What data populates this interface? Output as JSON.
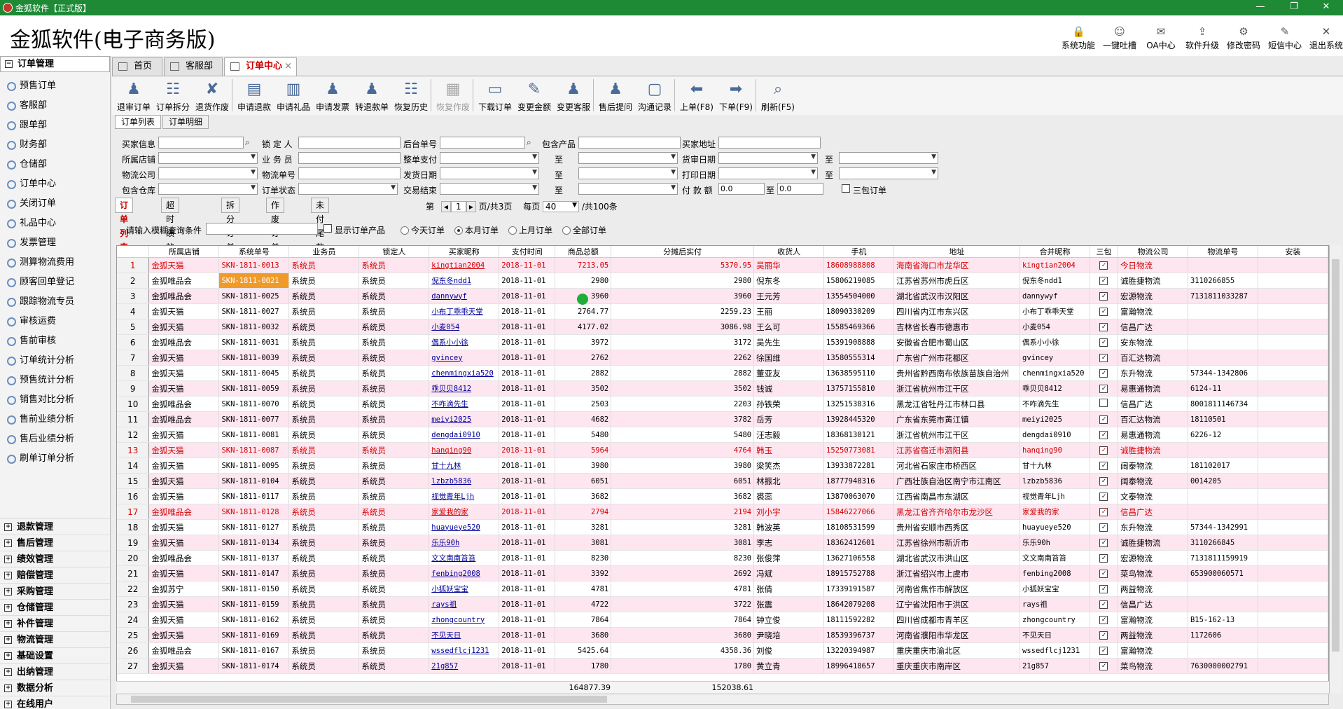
{
  "window": {
    "title": "金狐软件【正式版】",
    "controls": [
      "—",
      "❐",
      "✕"
    ]
  },
  "app_title": "金狐软件(电子商务版)",
  "header_buttons": [
    {
      "label": "系统功能",
      "icon": "lock-icon",
      "glyph": "🔒"
    },
    {
      "label": "一键吐槽",
      "icon": "smiley-icon",
      "glyph": "☺"
    },
    {
      "label": "OA中心",
      "icon": "mail-icon",
      "glyph": "✉"
    },
    {
      "label": "软件升级",
      "icon": "upgrade-icon",
      "glyph": "⇪"
    },
    {
      "label": "修改密码",
      "icon": "gear-icon",
      "glyph": "⚙"
    },
    {
      "label": "短信中心",
      "icon": "chat-icon",
      "glyph": "✎"
    },
    {
      "label": "退出系统",
      "icon": "exit-icon",
      "glyph": "✕"
    }
  ],
  "sidebar": {
    "section": "订单管理",
    "items": [
      "预售订单",
      "客服部",
      "跟单部",
      "财务部",
      "仓储部",
      "订单中心",
      "关闭订单",
      "礼品中心",
      "发票管理",
      "测算物流费用",
      "顾客回单登记",
      "跟踪物流专员",
      "审核运费",
      "售前审核",
      "订单统计分析",
      "预售统计分析",
      "销售对比分析",
      "售前业绩分析",
      "售后业绩分析",
      "刷单订单分析"
    ],
    "bottom": [
      "退款管理",
      "售后管理",
      "绩效管理",
      "赔偿管理",
      "采购管理",
      "仓储管理",
      "补件管理",
      "物流管理",
      "基础设置",
      "出纳管理",
      "数据分析",
      "在线用户"
    ]
  },
  "tabs": [
    "首页",
    "客服部",
    "订单中心"
  ],
  "toolbar": [
    {
      "label": "退审订单",
      "icon": "person-icon",
      "glyph": "♟"
    },
    {
      "label": "订单拆分",
      "icon": "database-icon",
      "glyph": "☷"
    },
    {
      "label": "退货作废",
      "icon": "doc-delete-icon",
      "glyph": "✘"
    },
    {
      "label": "申请退款",
      "icon": "form-icon",
      "glyph": "▤"
    },
    {
      "label": "申请礼品",
      "icon": "gift-icon",
      "glyph": "▥"
    },
    {
      "label": "申请发票",
      "icon": "person-warn-icon",
      "glyph": "♟"
    },
    {
      "label": "转退款单",
      "icon": "person-warn-icon",
      "glyph": "♟"
    },
    {
      "label": "恢复历史",
      "icon": "db-restore-icon",
      "glyph": "☷"
    },
    {
      "label": "恢复作废",
      "icon": "doc-icon",
      "glyph": "▦",
      "disabled": true
    },
    {
      "label": "下载订单",
      "icon": "monitor-icon",
      "glyph": "▭"
    },
    {
      "label": "变更金额",
      "icon": "pencil-icon",
      "glyph": "✎"
    },
    {
      "label": "变更客服",
      "icon": "person-icon",
      "glyph": "♟"
    },
    {
      "label": "售后提问",
      "icon": "person-icon",
      "glyph": "♟"
    },
    {
      "label": "沟通记录",
      "icon": "speech-icon",
      "glyph": "▢"
    },
    {
      "label": "上单(F8)",
      "icon": "arrow-left-icon",
      "glyph": "⬅"
    },
    {
      "label": "下单(F9)",
      "icon": "arrow-right-icon",
      "glyph": "➡"
    },
    {
      "label": "刷新(F5)",
      "icon": "magnifier-icon",
      "glyph": "⌕"
    }
  ],
  "subtabs": [
    "订单列表",
    "订单明细"
  ],
  "filters": {
    "买家信息": "买家信息",
    "锁定人": "锁 定 人",
    "后台单号": "后台单号",
    "包含产品": "包含产品",
    "买家地址": "买家地址",
    "所属店铺": "所属店铺",
    "业务员": "业 务 员",
    "整单支付": "整单支付",
    "至1": "至",
    "货审日期": "货审日期",
    "至2": "至",
    "物流公司": "物流公司",
    "物流单号": "物流单号",
    "发货日期": "发货日期",
    "至3": "至",
    "打印日期": "打印日期",
    "至4": "至",
    "包含仓库": "包含仓库",
    "订单状态": "订单状态",
    "交易结束": "交易结束",
    "至5": "至",
    "付款额": "付 款 额",
    "付款额从": "0.0",
    "至6": "至",
    "付款额到": "0.0",
    "三包订单": "三包订单"
  },
  "list_tabs": [
    "订单列表",
    "超时绩效统计",
    "拆分订单",
    "作废订单",
    "未付尾款预售订单"
  ],
  "pager": {
    "di": "第",
    "page": "1",
    "of": "页/共3页",
    "per_label": "每页",
    "per": "40",
    "total": "/共100条"
  },
  "search": {
    "label": "请输入模糊查询条件",
    "show_products": "显示订单产品",
    "radios": [
      "今天订单",
      "本月订单",
      "上月订单",
      "全部订单"
    ],
    "selected": "本月订单"
  },
  "columns": [
    "所属店铺",
    "系统单号",
    "业务员",
    "锁定人",
    "买家昵称",
    "支付时间",
    "商品总额",
    "分摊后实付",
    "收货人",
    "手机",
    "地址",
    "合并昵称",
    "三包",
    "物流公司",
    "物流单号",
    "安装"
  ],
  "rows": [
    [
      "金狐天猫",
      "SKN-1811-0013",
      "系统员",
      "系统员",
      "kingtian2004",
      "2018-11-01",
      "7213.05",
      "5370.95",
      "吴丽华",
      "18608988808",
      "海南省海口市龙华区",
      "kingtian2004",
      "1",
      "今日物流",
      "",
      "red-pink"
    ],
    [
      "金狐唯品会",
      "SKN-1811-0021",
      "系统员",
      "系统员",
      "倪东冬ndd1",
      "2018-11-01",
      "2980",
      "2980",
      "倪东冬",
      "15806219085",
      "江苏省苏州市虎丘区",
      "倪东冬ndd1",
      "1",
      "诚胜捷物流",
      "3110266855",
      "sel"
    ],
    [
      "金狐唯品会",
      "SKN-1811-0025",
      "系统员",
      "系统员",
      "dannywyf",
      "2018-11-01",
      "3960",
      "3960",
      "王元芳",
      "13554504000",
      "湖北省武汉市汉阳区",
      "dannywyf",
      "1",
      "宏源物流",
      "7131811033287",
      "pink"
    ],
    [
      "金狐天猫",
      "SKN-1811-0027",
      "系统员",
      "系统员",
      "小布丁乖乖天堂",
      "2018-11-01",
      "2764.77",
      "2259.23",
      "王丽",
      "18090330209",
      "四川省内江市东兴区",
      "小布丁乖乖天堂",
      "1",
      "富瀚物流",
      "",
      ""
    ],
    [
      "金狐天猫",
      "SKN-1811-0032",
      "系统员",
      "系统员",
      "小麦054",
      "2018-11-01",
      "4177.02",
      "3086.98",
      "王么可",
      "15585469366",
      "吉林省长春市德惠市",
      "小麦054",
      "1",
      "信昌广达",
      "",
      "pink"
    ],
    [
      "金狐唯品会",
      "SKN-1811-0031",
      "系统员",
      "系统员",
      "偶系小小徐",
      "2018-11-01",
      "3972",
      "3172",
      "吴先生",
      "15391908888",
      "安徽省合肥市蜀山区",
      "偶系小小徐",
      "1",
      "安东物流",
      "",
      ""
    ],
    [
      "金狐天猫",
      "SKN-1811-0039",
      "系统员",
      "系统员",
      "gvincey",
      "2018-11-01",
      "2762",
      "2262",
      "徐国维",
      "13580555314",
      "广东省广州市花都区",
      "gvincey",
      "1",
      "百汇达物流",
      "",
      "pink"
    ],
    [
      "金狐天猫",
      "SKN-1811-0045",
      "系统员",
      "系统员",
      "chenmingxia520",
      "2018-11-01",
      "2882",
      "2882",
      "董亚友",
      "13638595110",
      "贵州省黔西南布依族苗族自治州",
      "chenmingxia520",
      "1",
      "东升物流",
      "57344-1342806",
      ""
    ],
    [
      "金狐天猫",
      "SKN-1811-0059",
      "系统员",
      "系统员",
      "乖贝贝8412",
      "2018-11-01",
      "3502",
      "3502",
      "钱诚",
      "13757155810",
      "浙江省杭州市江干区",
      "乖贝贝8412",
      "1",
      "易惠通物流",
      "6124-11",
      "pink"
    ],
    [
      "金狐唯品会",
      "SKN-1811-0070",
      "系统员",
      "系统员",
      "不咋滴先生",
      "2018-11-01",
      "2503",
      "2203",
      "孙铁荣",
      "13251538316",
      "黑龙江省牡丹江市林口县",
      "不咋滴先生",
      "0",
      "信昌广达",
      "8001811146734",
      ""
    ],
    [
      "金狐唯品会",
      "SKN-1811-0077",
      "系统员",
      "系统员",
      "meiyi2025",
      "2018-11-01",
      "4682",
      "3782",
      "岳芳",
      "13928445320",
      "广东省东莞市黄江镇",
      "meiyi2025",
      "1",
      "百汇达物流",
      "18110501",
      "pink"
    ],
    [
      "金狐天猫",
      "SKN-1811-0081",
      "系统员",
      "系统员",
      "dengdai0910",
      "2018-11-01",
      "5480",
      "5480",
      "汪志毅",
      "18368130121",
      "浙江省杭州市江干区",
      "dengdai0910",
      "1",
      "易惠通物流",
      "6226-12",
      ""
    ],
    [
      "金狐天猫",
      "SKN-1811-0087",
      "系统员",
      "系统员",
      "hanqing90",
      "2018-11-01",
      "5964",
      "4764",
      "韩玉",
      "15250773081",
      "江苏省宿迁市泗阳县",
      "hanqing90",
      "1",
      "诚胜捷物流",
      "",
      "red-pink"
    ],
    [
      "金狐天猫",
      "SKN-1811-0095",
      "系统员",
      "系统员",
      "甘十九林",
      "2018-11-01",
      "3980",
      "3980",
      "梁笑杰",
      "13933872281",
      "河北省石家庄市桥西区",
      "甘十九林",
      "1",
      "阔泰物流",
      "181102017",
      ""
    ],
    [
      "金狐天猫",
      "SKN-1811-0104",
      "系统员",
      "系统员",
      "lzbzb5836",
      "2018-11-01",
      "6051",
      "6051",
      "林振北",
      "18777948316",
      "广西壮族自治区南宁市江南区",
      "lzbzb5836",
      "1",
      "阔泰物流",
      "0014205",
      "pink"
    ],
    [
      "金狐天猫",
      "SKN-1811-0117",
      "系统员",
      "系统员",
      "视觉青年Ljh",
      "2018-11-01",
      "3682",
      "3682",
      "裘蕊",
      "13870063070",
      "江西省南昌市东湖区",
      "视觉青年Ljh",
      "1",
      "文泰物流",
      "",
      ""
    ],
    [
      "金狐唯品会",
      "SKN-1811-0128",
      "系统员",
      "系统员",
      "家爱我的家",
      "2018-11-01",
      "2794",
      "2194",
      "刘小宇",
      "15846227066",
      "黑龙江省齐齐哈尔市龙沙区",
      "家爱我的家",
      "1",
      "信昌广达",
      "",
      "red-pink"
    ],
    [
      "金狐天猫",
      "SKN-1811-0127",
      "系统员",
      "系统员",
      "huayueye520",
      "2018-11-01",
      "3281",
      "3281",
      "韩波英",
      "18108531599",
      "贵州省安顺市西秀区",
      "huayueye520",
      "1",
      "东升物流",
      "57344-1342991",
      ""
    ],
    [
      "金狐天猫",
      "SKN-1811-0134",
      "系统员",
      "系统员",
      "乐乐90h",
      "2018-11-01",
      "3081",
      "3081",
      "李志",
      "18362412601",
      "江苏省徐州市新沂市",
      "乐乐90h",
      "1",
      "诚胜捷物流",
      "3110266845",
      "pink"
    ],
    [
      "金狐唯品会",
      "SKN-1811-0137",
      "系统员",
      "系统员",
      "文文南南笞笞",
      "2018-11-01",
      "8230",
      "8230",
      "张俊萍",
      "13627106558",
      "湖北省武汉市洪山区",
      "文文南南笞笞",
      "1",
      "宏源物流",
      "7131811159919",
      ""
    ],
    [
      "金狐天猫",
      "SKN-1811-0147",
      "系统员",
      "系统员",
      "fenbing2008",
      "2018-11-01",
      "3392",
      "2692",
      "冯斌",
      "18915752788",
      "浙江省绍兴市上虞市",
      "fenbing2008",
      "1",
      "菜鸟物流",
      "653900060571",
      "pink"
    ],
    [
      "金狐苏宁",
      "SKN-1811-0150",
      "系统员",
      "系统员",
      "小狐妖宝宝",
      "2018-11-01",
      "4781",
      "4781",
      "张倩",
      "17339191587",
      "河南省焦作市解放区",
      "小狐妖宝宝",
      "1",
      "两益物流",
      "",
      ""
    ],
    [
      "金狐天猫",
      "SKN-1811-0159",
      "系统员",
      "系统员",
      "rays祖",
      "2018-11-01",
      "4722",
      "3722",
      "张震",
      "18642079208",
      "辽宁省沈阳市于洪区",
      "rays祖",
      "1",
      "信昌广达",
      "",
      "pink"
    ],
    [
      "金狐天猫",
      "SKN-1811-0162",
      "系统员",
      "系统员",
      "zhongcountry",
      "2018-11-01",
      "7864",
      "7864",
      "钟立俊",
      "18111592282",
      "四川省成都市青羊区",
      "zhongcountry",
      "1",
      "富瀚物流",
      "B15-162-13",
      ""
    ],
    [
      "金狐天猫",
      "SKN-1811-0169",
      "系统员",
      "系统员",
      "不见天日",
      "2018-11-01",
      "3680",
      "3680",
      "尹晓培",
      "18539396737",
      "河南省濮阳市华龙区",
      "不见天日",
      "1",
      "两益物流",
      "1172606",
      "pink"
    ],
    [
      "金狐唯品会",
      "SKN-1811-0167",
      "系统员",
      "系统员",
      "wssedflcj1231",
      "2018-11-01",
      "5425.64",
      "4358.36",
      "刘俊",
      "13220394987",
      "重庆重庆市渝北区",
      "wssedflcj1231",
      "1",
      "富瀚物流",
      "",
      ""
    ],
    [
      "金狐天猫",
      "SKN-1811-0174",
      "系统员",
      "系统员",
      "21g857",
      "2018-11-01",
      "1780",
      "1780",
      "黄立青",
      "18996418657",
      "重庆重庆市南岸区",
      "21g857",
      "1",
      "菜鸟物流",
      "7630000002791",
      "pink"
    ]
  ],
  "totals": {
    "goods": "164877.39",
    "paid": "152038.61"
  },
  "colors": {
    "titlebar": "#1e8a36",
    "pink_row": "#fde6f0",
    "red_text": "#d40000",
    "selected": "#f09a2a",
    "link": "#00009a"
  }
}
